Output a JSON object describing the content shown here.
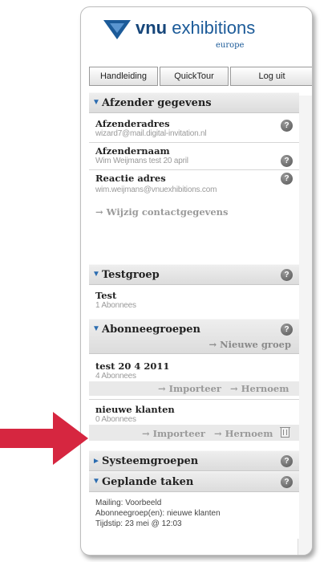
{
  "logo": {
    "name_bold": "vnu",
    "name_rest": " exhibitions",
    "subtitle": "europe"
  },
  "toolbar": {
    "manual": "Handleiding",
    "quicktour": "QuickTour",
    "logout": "Log uit"
  },
  "sender": {
    "header": "Afzender gegevens",
    "address_label": "Afzenderadres",
    "address_value": "wizard7@mail.digital-invitation.nl",
    "name_label": "Afzendernaam",
    "name_value": "Wim Weijmans test 20 april",
    "reply_label": "Reactie adres",
    "reply_value": "wim.weijmans@vnuexhibitions.com",
    "change_link": "→ Wijzig contactgegevens"
  },
  "testgroup": {
    "header": "Testgroep",
    "name": "Test",
    "count": "1 Abonnees"
  },
  "subscriber_groups": {
    "header": "Abonneegroepen",
    "new_group": "→ Nieuwe groep",
    "groups": [
      {
        "name": "test 20 4 2011",
        "count": "4 Abonnees",
        "import": "→ Importeer",
        "rename": "→ Hernoem"
      },
      {
        "name": "nieuwe klanten",
        "count": "0 Abonnees",
        "import": "→ Importeer",
        "rename": "→ Hernoem"
      }
    ]
  },
  "system_groups": {
    "header": "Systeemgroepen"
  },
  "scheduled": {
    "header": "Geplande taken",
    "line1": "Mailing: Voorbeeld",
    "line2": "Abonneegroep(en): nieuwe klanten",
    "line3": "Tijdstip: 23 mei @ 12:03"
  },
  "help_symbol": "?",
  "colors": {
    "brand_blue": "#1c5b99",
    "arrow_red": "#d62640",
    "header_gray": "#dcdcdc",
    "muted_text": "#9a9a9a"
  }
}
